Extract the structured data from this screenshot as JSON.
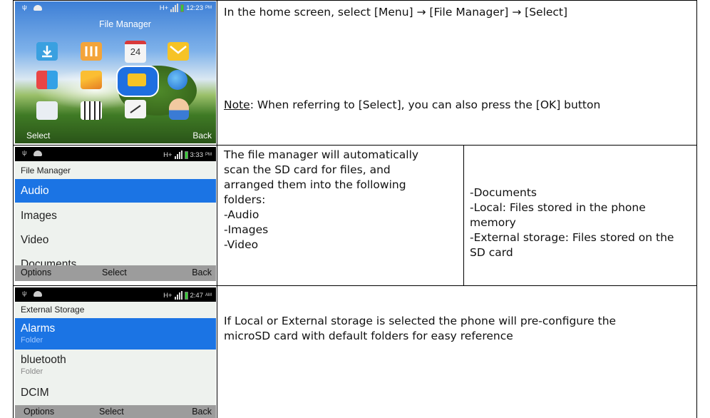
{
  "rows": [
    {
      "phone": {
        "time": "12:23",
        "ampm": "PM",
        "network": "H+",
        "title": "File Manager",
        "soft_left": "Select",
        "soft_right": "Back"
      },
      "text": {
        "line1": "In the home screen, select [Menu] → [File Manager] → [Select]",
        "note_label": "Note",
        "note_body": ": When referring to [Select], you can also press the [OK] button"
      }
    },
    {
      "phone": {
        "time": "3:33",
        "ampm": "PM",
        "network": "H+",
        "title": "File Manager",
        "items": [
          "Audio",
          "Images",
          "Video",
          "Documents"
        ],
        "soft_left": "Options",
        "soft_mid": "Select",
        "soft_right": "Back"
      },
      "text_left": [
        "The file manager will automatically",
        "scan the SD card for files, and",
        "arranged them into the following",
        "folders:",
        "-Audio",
        "-Images",
        "-Video"
      ],
      "text_right": [
        "-Documents",
        "-Local: Files stored in the phone",
        "memory",
        "-External storage: Files stored on the",
        "SD card"
      ]
    },
    {
      "phone": {
        "time": "2:47",
        "ampm": "AM",
        "network": "H+",
        "title": "External Storage",
        "items": [
          {
            "name": "Alarms",
            "type": "Folder"
          },
          {
            "name": "bluetooth",
            "type": "Folder"
          },
          {
            "name": "DCIM",
            "type": ""
          }
        ],
        "soft_left": "Options",
        "soft_mid": "Select",
        "soft_right": "Back"
      },
      "text": {
        "line1": "If Local or External storage is selected the phone will pre-configure the",
        "line2": "microSD card with default folders for easy reference"
      }
    }
  ]
}
